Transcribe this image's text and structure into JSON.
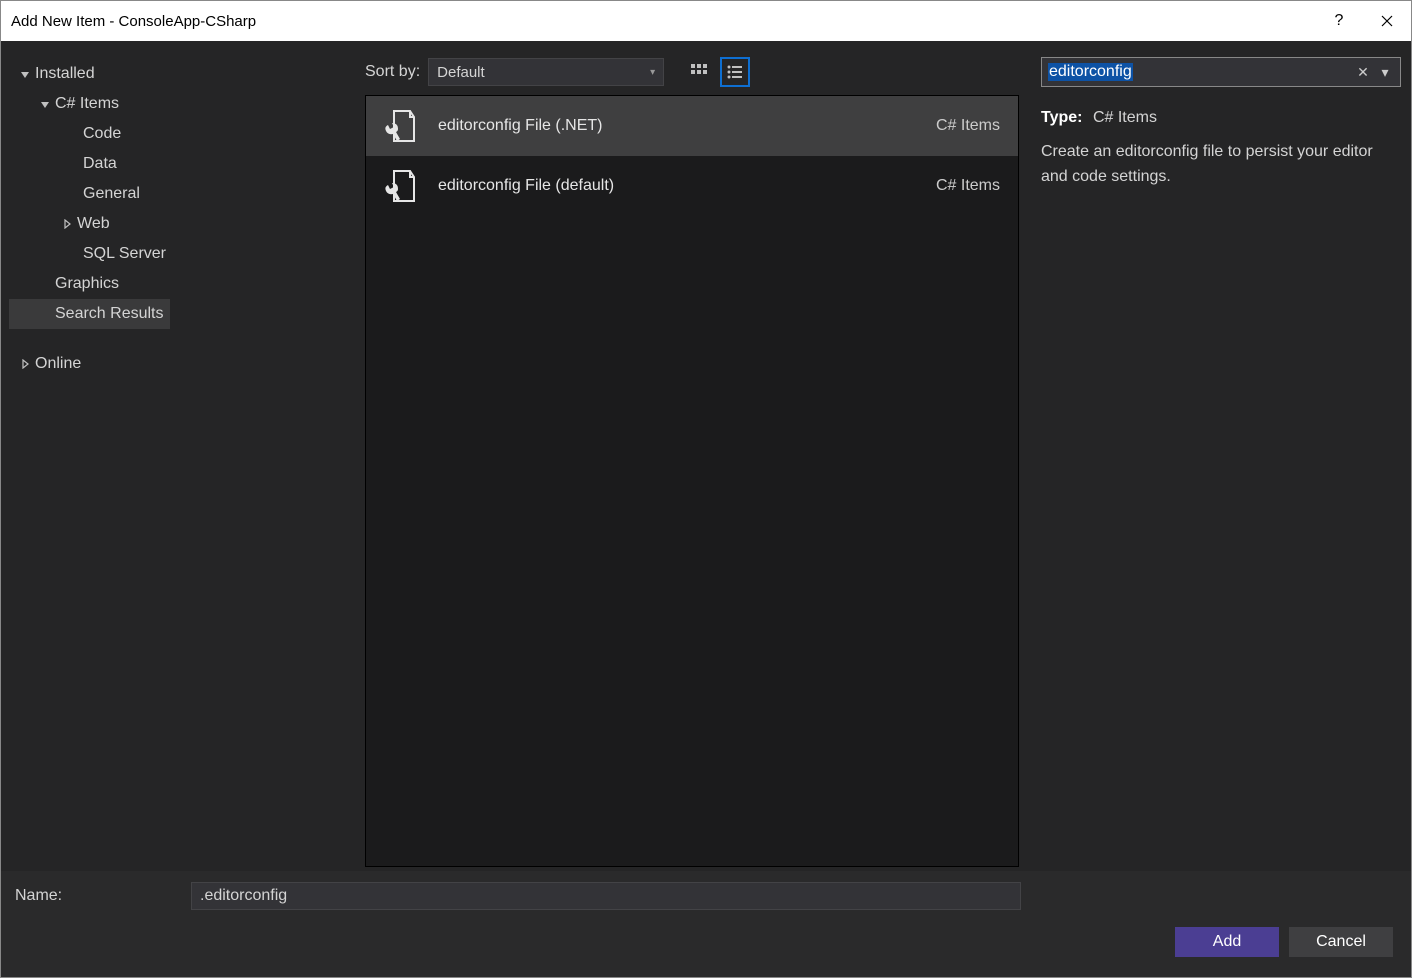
{
  "window": {
    "title": "Add New Item - ConsoleApp-CSharp"
  },
  "sidebar": {
    "installed": "Installed",
    "csharp_items": "C# Items",
    "children": {
      "code": "Code",
      "data": "Data",
      "general": "General",
      "web": "Web",
      "sqlserver": "SQL Server"
    },
    "graphics": "Graphics",
    "search_results": "Search Results",
    "online": "Online"
  },
  "toolbar": {
    "sort_label": "Sort by:",
    "sort_value": "Default"
  },
  "search": {
    "value": "editorconfig"
  },
  "templates": [
    {
      "name": "editorconfig File (.NET)",
      "category": "C# Items",
      "selected": true
    },
    {
      "name": "editorconfig File (default)",
      "category": "C# Items",
      "selected": false
    }
  ],
  "details": {
    "type_label": "Type:",
    "type_value": "C# Items",
    "description": "Create an editorconfig file to persist your editor and code settings."
  },
  "footer": {
    "name_label": "Name:",
    "name_value": ".editorconfig",
    "add": "Add",
    "cancel": "Cancel"
  }
}
